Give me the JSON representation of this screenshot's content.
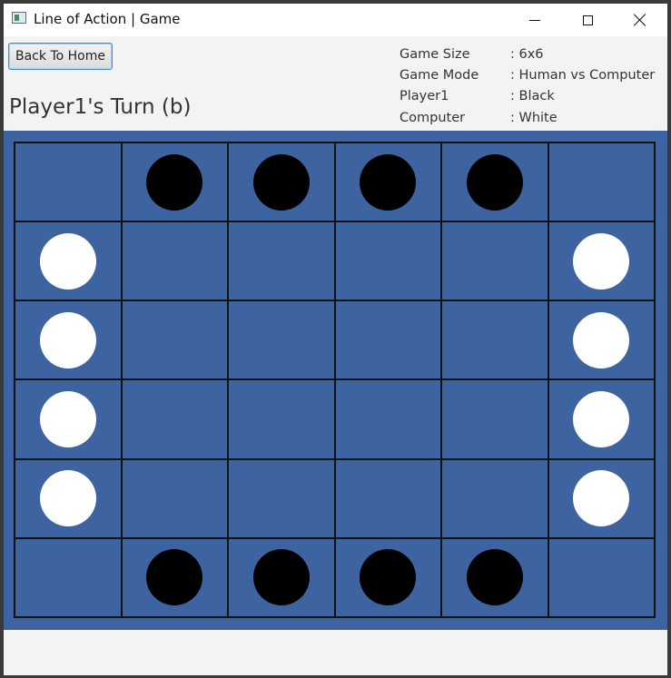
{
  "window": {
    "title": "Line of Action | Game"
  },
  "toolbar": {
    "back_label": "Back To Home"
  },
  "status": {
    "turn": "Player1's Turn (b)"
  },
  "info": [
    {
      "label": "Game Size",
      "value": ": 6x6"
    },
    {
      "label": "Game Mode",
      "value": ": Human vs Computer"
    },
    {
      "label": "Player1",
      "value": ": Black"
    },
    {
      "label": "Computer",
      "value": ": White"
    }
  ],
  "colors": {
    "board": "#3d63a1",
    "black_piece": "#000000",
    "white_piece": "#ffffff"
  },
  "board": {
    "size": 6,
    "cells": [
      [
        "",
        "b",
        "b",
        "b",
        "b",
        ""
      ],
      [
        "w",
        "",
        "",
        "",
        "",
        "w"
      ],
      [
        "w",
        "",
        "",
        "",
        "",
        "w"
      ],
      [
        "w",
        "",
        "",
        "",
        "",
        "w"
      ],
      [
        "w",
        "",
        "",
        "",
        "",
        "w"
      ],
      [
        "",
        "b",
        "b",
        "b",
        "b",
        ""
      ]
    ]
  }
}
